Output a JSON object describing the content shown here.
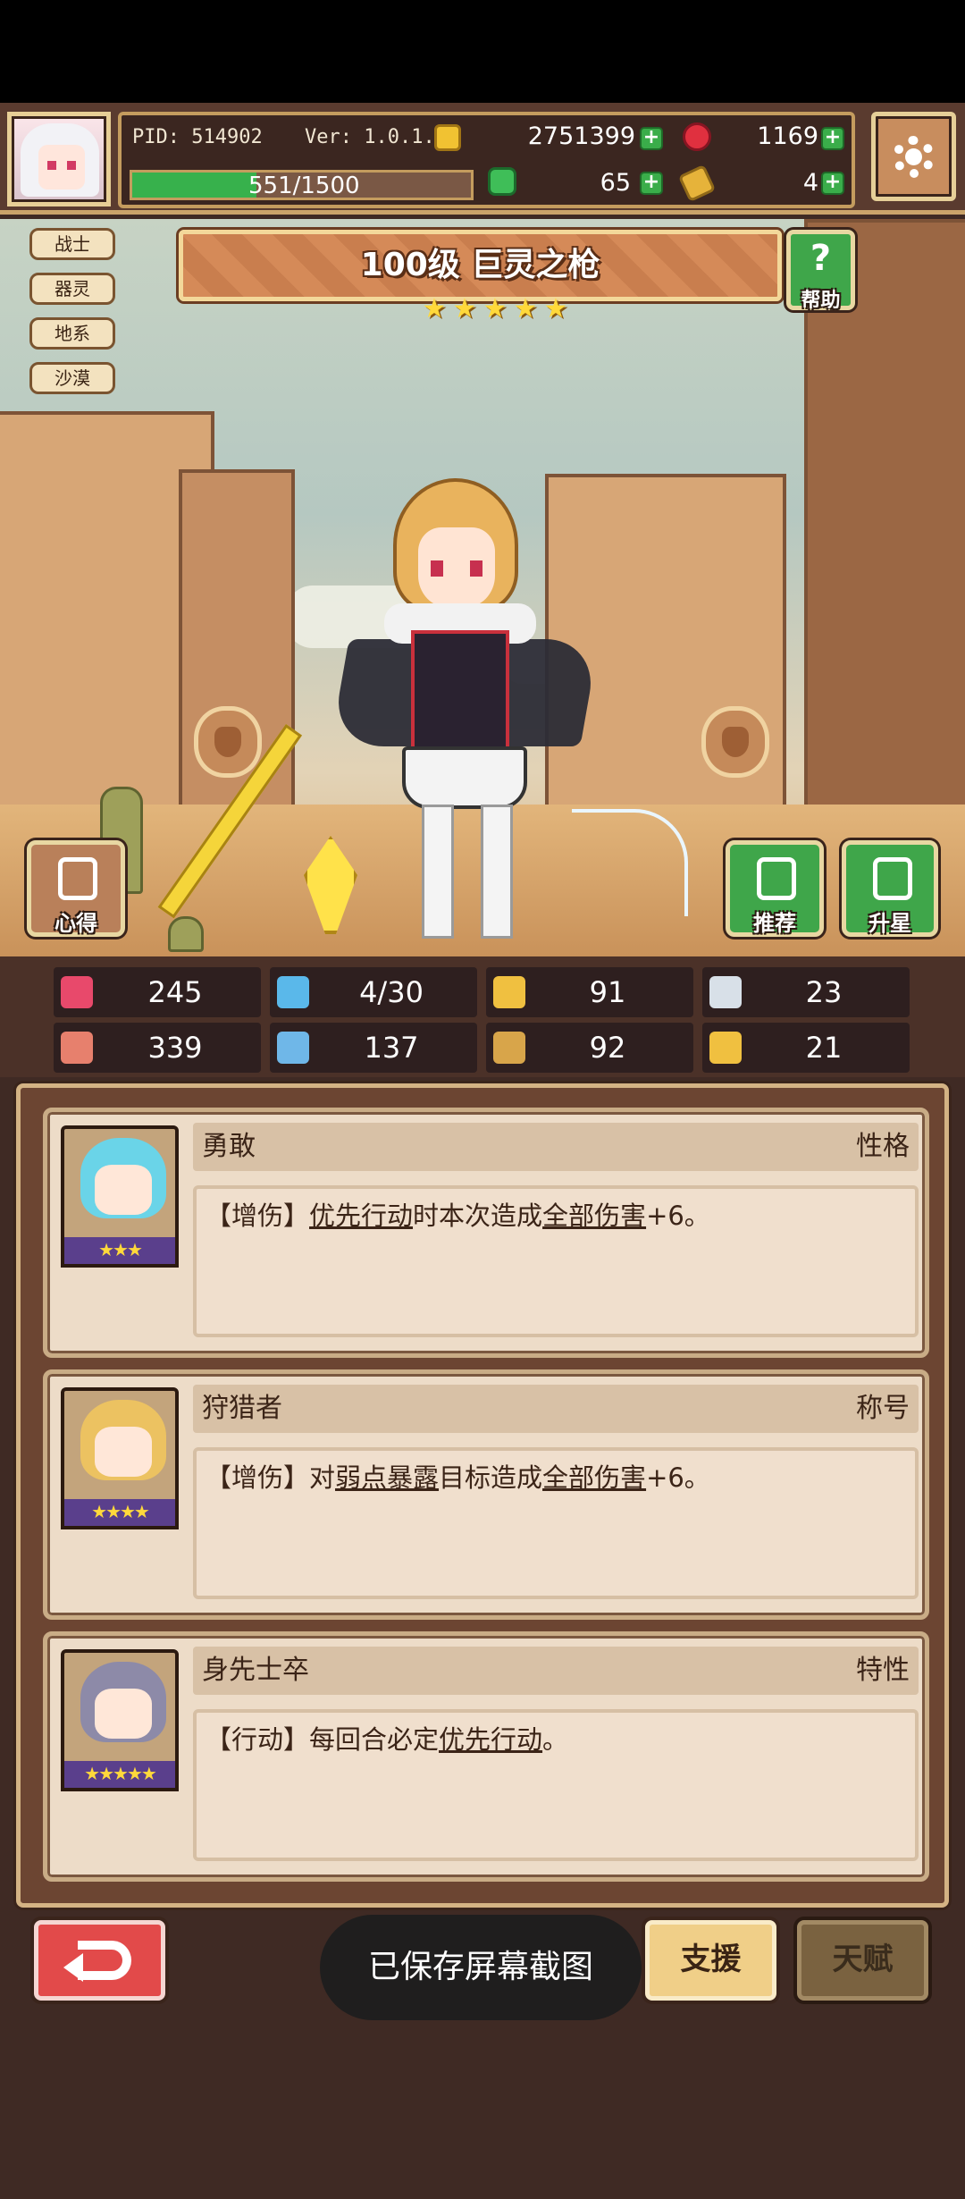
{
  "hud": {
    "pid": "PID: 514902",
    "version": "Ver: 1.0.1.2",
    "gold": "2751399",
    "gems": "1169",
    "xp_text": "551/1500",
    "xp_fraction": 0.367,
    "clover": "65",
    "tickets": "4",
    "plus": "+"
  },
  "tags": [
    "战士",
    "器灵",
    "地系",
    "沙漠"
  ],
  "hero": {
    "title": "100级  巨灵之枪",
    "stars": 5,
    "star_glyph": "★★★★★"
  },
  "buttons": {
    "help": "帮助",
    "help_glyph": "?",
    "notes": "心得",
    "recommend": "推荐",
    "star_up": "升星",
    "support": "支援",
    "talent": "天赋"
  },
  "stats": [
    {
      "icon": "heart-icon",
      "value": "245",
      "color": "#e8496b"
    },
    {
      "icon": "water-drop-icon",
      "value": "4/30",
      "color": "#5ab8ea"
    },
    {
      "icon": "shield-icon",
      "value": "91",
      "color": "#f0c040"
    },
    {
      "icon": "wing-icon",
      "value": "23",
      "color": "#d8e0e8"
    },
    {
      "icon": "fist-icon",
      "value": "339",
      "color": "#e7806d"
    },
    {
      "icon": "book-icon",
      "value": "137",
      "color": "#6fb7e8"
    },
    {
      "icon": "boot-icon",
      "value": "92",
      "color": "#d8a54a"
    },
    {
      "icon": "luck-icon",
      "value": "21",
      "color": "#f0c040"
    }
  ],
  "cards": [
    {
      "name": "勇敢",
      "type": "性格",
      "stars": "★★★",
      "prefix": "【增伤】",
      "u1": "优先行动",
      "mid": "时本次造成",
      "u2": "全部伤害",
      "suffix": "+6。"
    },
    {
      "name": "狩猎者",
      "type": "称号",
      "stars": "★★★★",
      "prefix": "【增伤】对",
      "u1": "弱点暴露",
      "mid": "目标造成",
      "u2": "全部伤害",
      "suffix": "+6。"
    },
    {
      "name": "身先士卒",
      "type": "特性",
      "stars": "★★★★★",
      "prefix": "【行动】每回合必定",
      "u1": "优先行动",
      "mid": "",
      "u2": "",
      "suffix": "。"
    }
  ],
  "toast": "已保存屏幕截图"
}
